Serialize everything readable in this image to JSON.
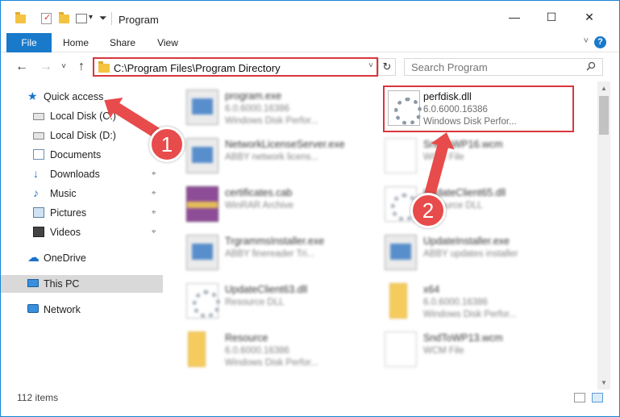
{
  "window": {
    "title": "Program",
    "minimize_icon": "minimize-icon",
    "maximize_icon": "maximize-icon",
    "close_icon": "close-icon",
    "minimize_glyph": "—",
    "maximize_glyph": "☐",
    "close_glyph": "✕"
  },
  "ribbon": {
    "tabs": [
      "File",
      "Home",
      "Share",
      "View"
    ],
    "help_label": "?",
    "collapse_glyph": "˅"
  },
  "nav": {
    "back_glyph": "←",
    "forward_glyph": "→",
    "recent_glyph": "˅",
    "up_glyph": "↑",
    "address": "C:\\Program Files\\Program Directory",
    "address_dropdown_glyph": "˅",
    "refresh_glyph": "↻",
    "search_placeholder": "Search Program"
  },
  "sidebar": {
    "items": [
      {
        "label": "Quick access",
        "icon": "star-icon",
        "glyph": "★"
      },
      {
        "label": "Local Disk (C:)",
        "icon": "disk-icon",
        "pin": ""
      },
      {
        "label": "Local Disk (D:)",
        "icon": "disk-icon",
        "pin": ""
      },
      {
        "label": "Documents",
        "icon": "documents-icon",
        "pin": "⌖"
      },
      {
        "label": "Downloads",
        "icon": "download-icon",
        "glyph": "↓",
        "pin": "⌖"
      },
      {
        "label": "Music",
        "icon": "music-icon",
        "glyph": "♪",
        "pin": "⌖"
      },
      {
        "label": "Pictures",
        "icon": "pictures-icon",
        "pin": "⌖"
      },
      {
        "label": "Videos",
        "icon": "videos-icon",
        "pin": "⌖"
      },
      {
        "label": "OneDrive",
        "icon": "onedrive-icon",
        "glyph": "☁"
      },
      {
        "label": "This PC",
        "icon": "computer-icon",
        "selected": true
      },
      {
        "label": "Network",
        "icon": "network-icon"
      }
    ]
  },
  "files": [
    {
      "name": "program.exe",
      "line2": "6.0.6000.16386",
      "line3": "Windows Disk Perfor...",
      "type": "exe"
    },
    {
      "name": "perfdisk.dll",
      "line2": "6.0.6000.16386",
      "line3": "Windows Disk Perfor...",
      "type": "dll",
      "highlighted": true
    },
    {
      "name": "NetworkLicenseServer.exe",
      "line2": "ABBY network licens...",
      "line3": "",
      "type": "exe"
    },
    {
      "name": "SndToWP16.wcm",
      "line2": "WCM File",
      "line3": "",
      "type": "plain"
    },
    {
      "name": "certificates.cab",
      "line2": "WinRAR Archive",
      "line3": "",
      "type": "rar"
    },
    {
      "name": "UpdateClient65.dll",
      "line2": "Resource DLL",
      "line3": "",
      "type": "dll"
    },
    {
      "name": "TrgrammsInstaller.exe",
      "line2": "ABBY finereader Tri...",
      "line3": "",
      "type": "exe"
    },
    {
      "name": "UpdateInstaller.exe",
      "line2": "ABBY updates installer",
      "line3": "",
      "type": "exe"
    },
    {
      "name": "UpdateClient63.dll",
      "line2": "Resource DLL",
      "line3": "",
      "type": "dll"
    },
    {
      "name": "x64",
      "line2": "6.0.6000.16386",
      "line3": "Windows Disk Perfor...",
      "type": "folder"
    },
    {
      "name": "Resource",
      "line2": "6.0.6000.16386",
      "line3": "Windows Disk Perfor...",
      "type": "folder"
    },
    {
      "name": "SndToWP13.wcm",
      "line2": "WCM File",
      "line3": "",
      "type": "plain"
    }
  ],
  "annotations": {
    "step1": "1",
    "step2": "2",
    "accent": "#e84b4b"
  },
  "status": {
    "item_count": "112 items"
  },
  "colors": {
    "ribbon_file_tab": "#1979ca",
    "highlight_border": "#d9363e",
    "selected_nav": "#d9d9d9"
  }
}
